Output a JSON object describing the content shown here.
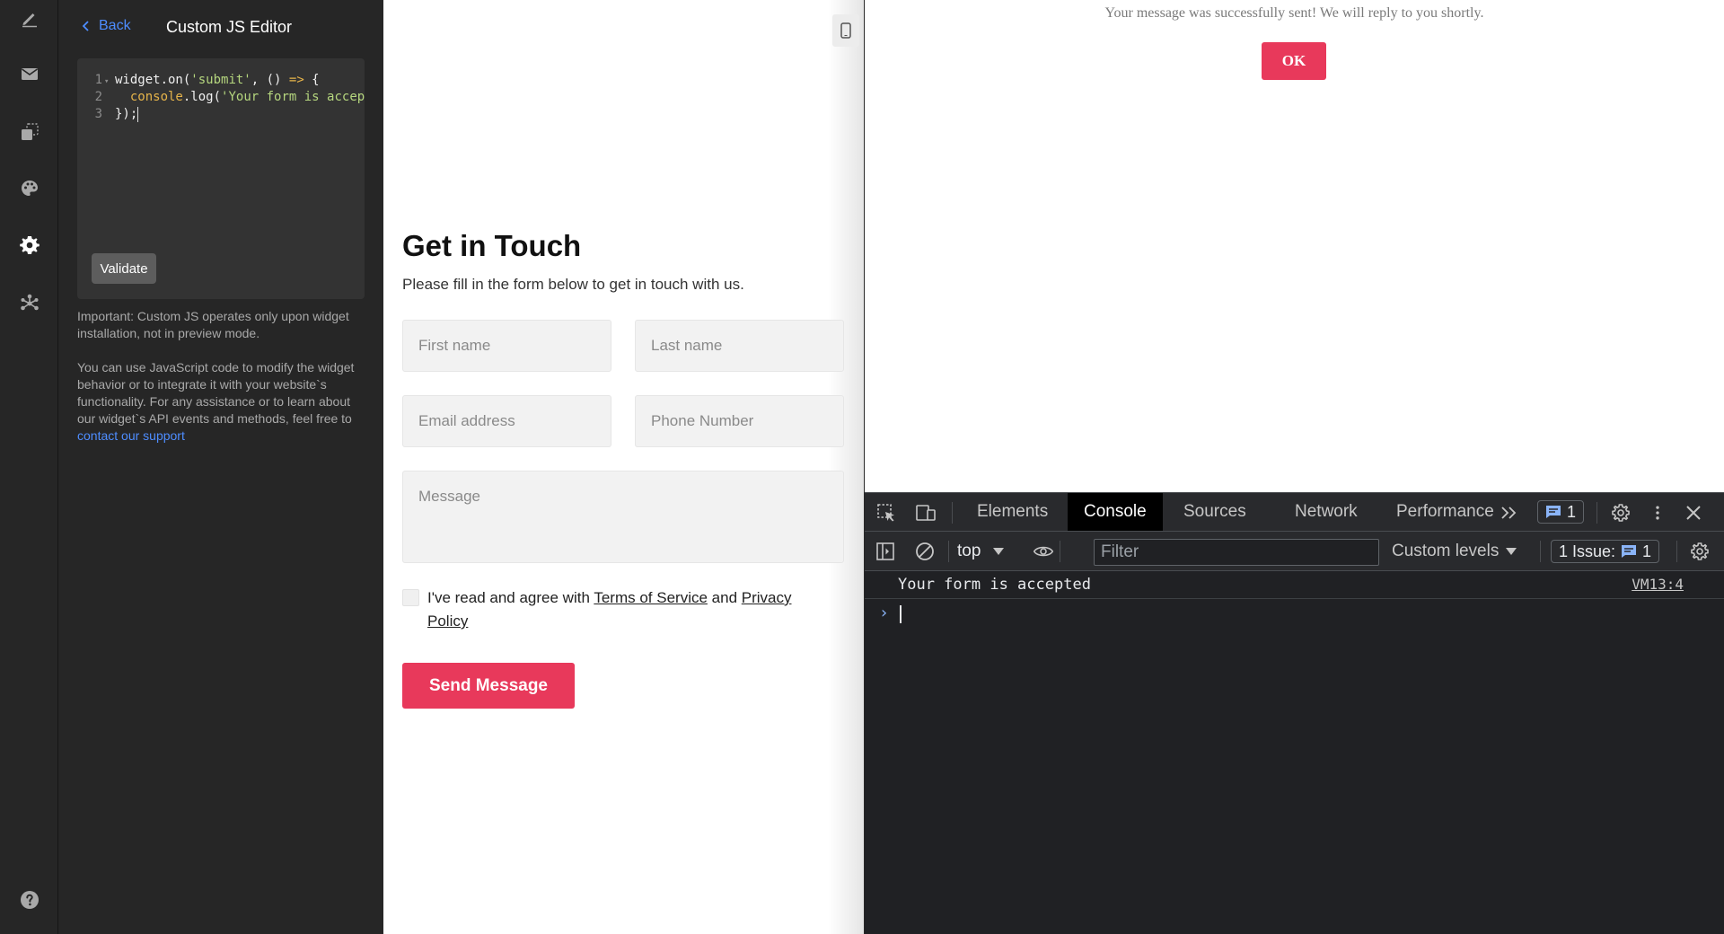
{
  "rail": {
    "icons": [
      "pencil-icon",
      "mail-icon",
      "layers-icon",
      "palette-icon",
      "gear-icon",
      "integrations-icon",
      "help-icon"
    ]
  },
  "editor": {
    "back_label": "Back",
    "title": "Custom JS Editor",
    "code": {
      "line_numbers": [
        "1",
        "2",
        "3"
      ],
      "line1_a": "widget.on(",
      "line1_str": "'submit'",
      "line1_b": ", () ",
      "line1_arrow": "=>",
      "line1_c": " {",
      "line2_indent": "  ",
      "line2_kw": "console",
      "line2_b": ".log(",
      "line2_str": "'Your form is accep",
      "line3": "});"
    },
    "validate_label": "Validate",
    "note": "Important: Custom JS operates only upon widget installation, not in preview mode.",
    "help_text": "You can use JavaScript code to modify the widget behavior or to integrate it with your website`s functionality. For any assistance or to learn about our widget`s API events and methods, feel free to ",
    "help_link": "contact our support"
  },
  "form": {
    "title": "Get in Touch",
    "subtitle": "Please fill in the form below to get in touch with us.",
    "first_name_placeholder": "First name",
    "last_name_placeholder": "Last name",
    "email_placeholder": "Email address",
    "phone_placeholder": "Phone Number",
    "message_placeholder": "Message",
    "agree_prefix": "I've read and agree with ",
    "terms_link": "Terms of Service",
    "agree_mid": " and ",
    "privacy_link": "Privacy Policy",
    "send_label": "Send Message"
  },
  "page": {
    "success_message": "Your message was successfully sent! We will reply to you shortly.",
    "ok_label": "OK"
  },
  "devtools": {
    "tabs": [
      "Elements",
      "Console",
      "Sources",
      "Network",
      "Performance"
    ],
    "active_tab": "Console",
    "message_badge_count": "1",
    "context": "top",
    "filter_placeholder": "Filter",
    "levels_label": "Custom levels",
    "issues_label": "1 Issue:",
    "issues_count": "1",
    "console_message": "Your form is accepted",
    "console_source": "VM13:4",
    "prompt_symbol": "›"
  },
  "colors": {
    "accent": "#e8395b",
    "link": "#4e8dff",
    "panel_bg": "#262626",
    "devtools_bg": "#202124"
  }
}
